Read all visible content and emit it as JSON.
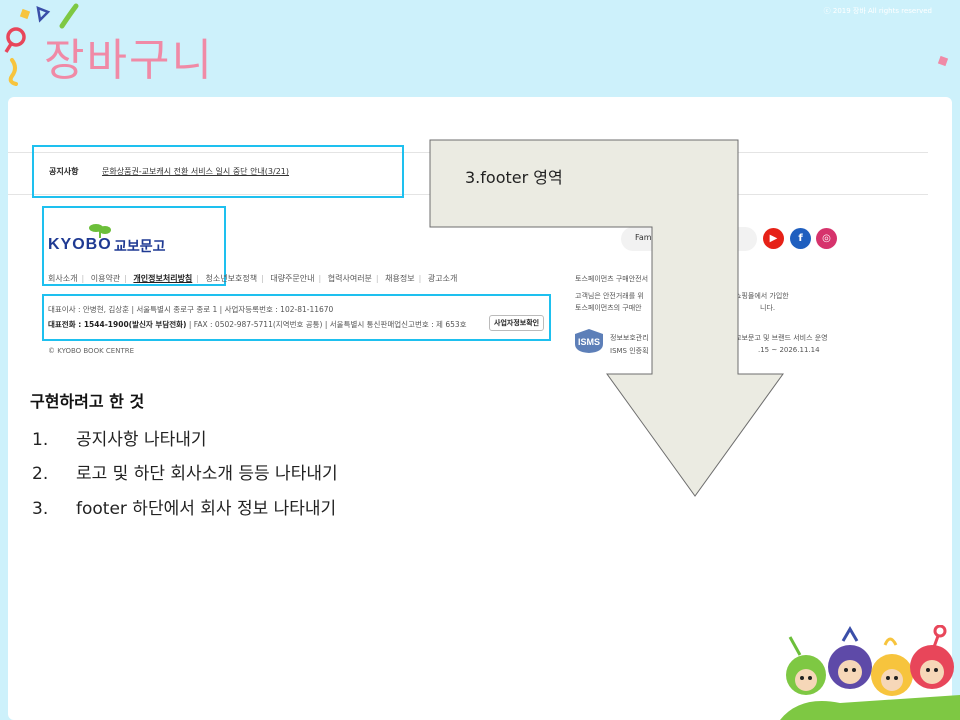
{
  "slide": {
    "title": "장바구니",
    "copyright": "ⓒ 2019 장바 All rights reserved"
  },
  "footer_capture": {
    "notice": {
      "label": "공지사항",
      "link": "문화상품권-교보캐시 전환 서비스 일시 중단 안내(3/21)"
    },
    "logo": {
      "text_en": "KYOBO",
      "text_kr": "교보문고"
    },
    "links": [
      "회사소개",
      "이용약관",
      "개인정보처리방침",
      "청소년보호정책",
      "대량주문안내",
      "협력사여러분",
      "채용정보",
      "광고소개"
    ],
    "info_line1": "대표이사 : 안병현, 김상훈 | 서울특별시 종로구 종로 1 | 사업자등록번호 : 102-81-11670",
    "info_line2_bold": "대표전화 : 1544-1900(발신자 부담전화)",
    "info_line2_rest": " | FAX : 0502-987-5711(지역번호 공통) | 서울특별시 통신판매업신고번호 : 제 653호",
    "biz_button": "사업자정보확인",
    "copyright": "© KYOBO BOOK CENTRE",
    "family_site": "Fam",
    "sns": [
      "youtube-icon",
      "facebook-icon",
      "instagram-icon"
    ],
    "right_texts": {
      "escrow_title": "토스페이먼츠 구매안전서",
      "escrow_line1": "고객님은 안전거래를 위",
      "escrow_line1b": "쇼핑몰에서 가입한",
      "escrow_line2": "토스페이먼츠의 구매안",
      "escrow_line2b": "니다.",
      "isms_label": "ISMS",
      "isms_line1": "정보보호관리",
      "isms_line1b": "교보문고 및 브랜드 서비스 운영",
      "isms_line2": "ISMS 인증획",
      "isms_line2b": ".15 ~ 2026.11.14"
    }
  },
  "annotation": {
    "label": "3.footer 영역"
  },
  "description": {
    "title": "구현하려고 한 것",
    "items": [
      {
        "num": "1.",
        "text": "공지사항 나타내기"
      },
      {
        "num": "2.",
        "text": "로고 및 하단 회사소개 등등 나타내기"
      },
      {
        "num": "3.",
        "text": "footer 하단에서 회사 정보 나타내기"
      }
    ]
  },
  "colors": {
    "background": "#cdf1fb",
    "title": "#f08aa6",
    "highlight": "#1ec0ef",
    "note_fill": "#ebebe2",
    "kyobo_blue": "#1f3a93"
  }
}
